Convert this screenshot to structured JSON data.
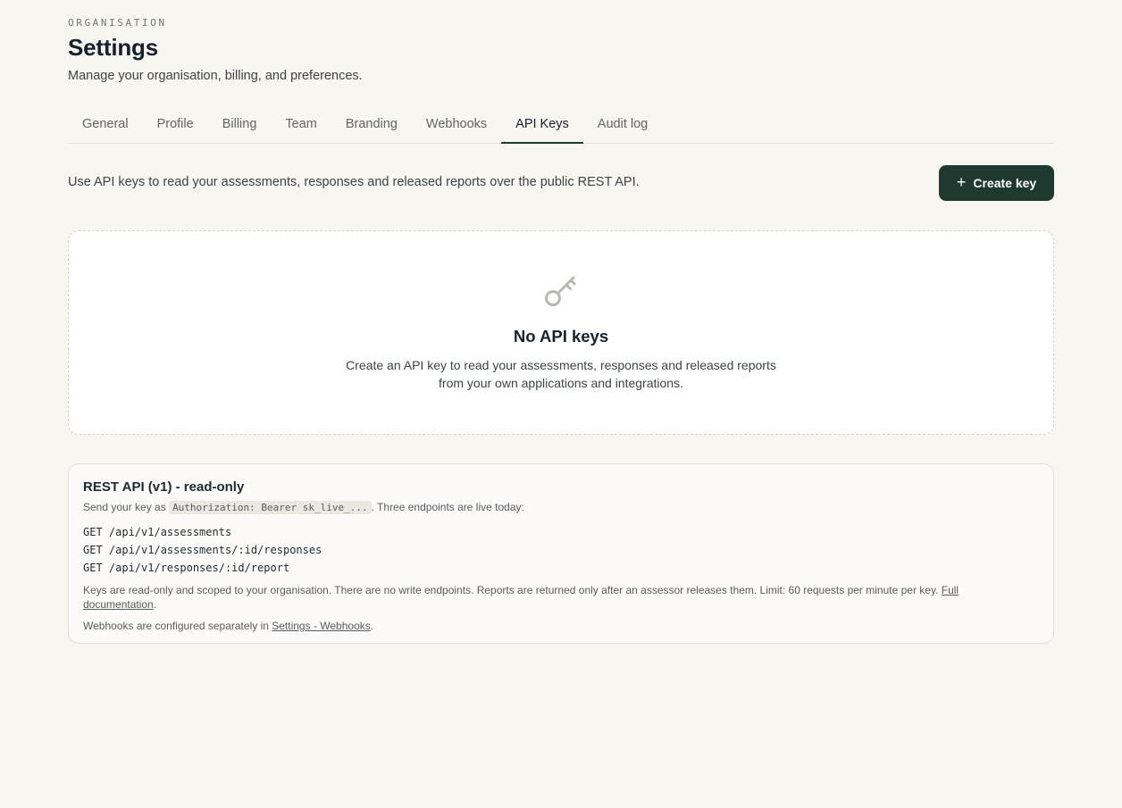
{
  "header": {
    "eyebrow": "ORGANISATION",
    "title": "Settings",
    "subtitle": "Manage your organisation, billing, and preferences."
  },
  "tabs": [
    {
      "label": "General",
      "active": false
    },
    {
      "label": "Profile",
      "active": false
    },
    {
      "label": "Billing",
      "active": false
    },
    {
      "label": "Team",
      "active": false
    },
    {
      "label": "Branding",
      "active": false
    },
    {
      "label": "Webhooks",
      "active": false
    },
    {
      "label": "API Keys",
      "active": true
    },
    {
      "label": "Audit log",
      "active": false
    }
  ],
  "api_keys": {
    "intro": "Use API keys to read your assessments, responses and released reports over the public REST API.",
    "create_button": {
      "icon": "plus-icon",
      "label": "Create key"
    },
    "empty_state": {
      "icon": "key-icon",
      "title": "No API keys",
      "text": "Create an API key to read your assessments, responses and released reports from your own applications and integrations."
    }
  },
  "rest_api": {
    "title": "REST API (v1) - read-only",
    "send_prefix": "Send your key as ",
    "auth_header": "Authorization: Bearer sk_live_...",
    "send_suffix": ". Three endpoints are live today:",
    "endpoints": [
      "GET /api/v1/assessments",
      "GET /api/v1/assessments/:id/responses",
      "GET /api/v1/responses/:id/report"
    ],
    "note": "Keys are read-only and scoped to your organisation. There are no write endpoints. Reports are returned only after an assessor releases them. Limit: 60 requests per minute per key.",
    "doc_link": "Full documentation",
    "webhooks_prefix": "Webhooks are configured separately in ",
    "webhooks_link": "Settings - Webhooks"
  },
  "colors": {
    "background": "#f8f6f1",
    "primary_button": "#1e3a30",
    "active_tab_underline": "#1f3a31",
    "card_background": "#ffffff"
  }
}
